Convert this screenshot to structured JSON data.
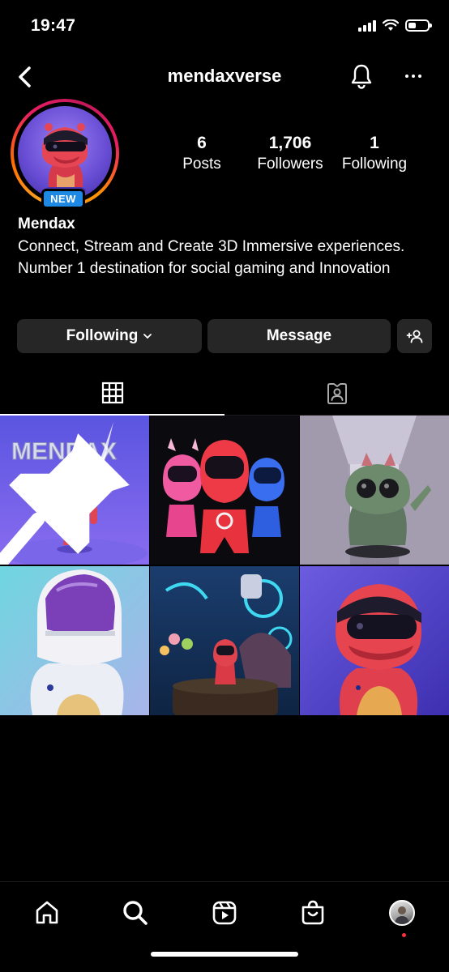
{
  "status_bar": {
    "time": "19:47",
    "battery_level": 0.4
  },
  "header": {
    "username": "mendaxverse"
  },
  "profile": {
    "badge": "NEW",
    "display_name": "Mendax",
    "bio": "Connect, Stream and Create 3D Immersive experiences. Number 1 destination for social gaming and Innovation",
    "stats": [
      {
        "value": "6",
        "label": "Posts"
      },
      {
        "value": "1,706",
        "label": "Followers"
      },
      {
        "value": "1",
        "label": "Following"
      }
    ]
  },
  "actions": {
    "following_label": "Following",
    "message_label": "Message"
  },
  "tabs": [
    {
      "name": "grid-icon",
      "active": true
    },
    {
      "name": "tagged-icon",
      "active": false
    }
  ],
  "posts": [
    {
      "pinned": true,
      "overlay_text": "MENDAX"
    },
    {
      "pinned": false
    },
    {
      "pinned": false
    },
    {
      "pinned": false
    },
    {
      "pinned": false
    },
    {
      "pinned": false
    }
  ],
  "bottom_nav": [
    {
      "icon": "home-icon"
    },
    {
      "icon": "search-icon"
    },
    {
      "icon": "reels-icon"
    },
    {
      "icon": "shop-icon"
    },
    {
      "icon": "profile-avatar"
    }
  ],
  "colors": {
    "accent_badge": "#1e88e5",
    "button_bg": "#262626",
    "background": "#000000",
    "notification_dot": "#ff3040"
  }
}
